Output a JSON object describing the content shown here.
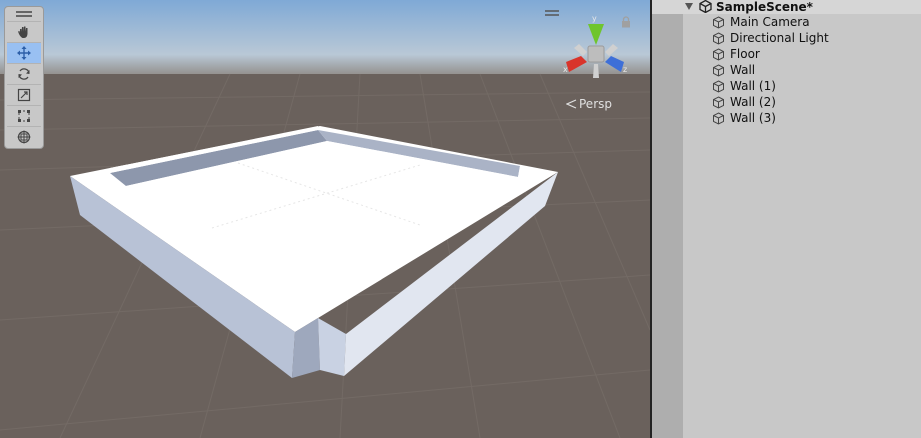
{
  "scene_view": {
    "camera_mode": "Persp",
    "tools": [
      {
        "name": "hand-tool",
        "active": false
      },
      {
        "name": "move-tool",
        "active": true
      },
      {
        "name": "rotate-tool",
        "active": false
      },
      {
        "name": "scale-tool",
        "active": false
      },
      {
        "name": "rect-tool",
        "active": false
      },
      {
        "name": "transform-tool",
        "active": false
      }
    ],
    "gizmo_axes": {
      "y": "y",
      "x": "x",
      "z": "z"
    }
  },
  "hierarchy": {
    "scene_name": "SampleScene*",
    "items": [
      "Main Camera",
      "Directional Light",
      "Floor",
      "Wall",
      "Wall (1)",
      "Wall (2)",
      "Wall (3)"
    ]
  },
  "colors": {
    "active_tool": "#99c0f2",
    "axis_x": "#d9342b",
    "axis_y": "#6fc52d",
    "axis_z": "#3d6fd8"
  }
}
